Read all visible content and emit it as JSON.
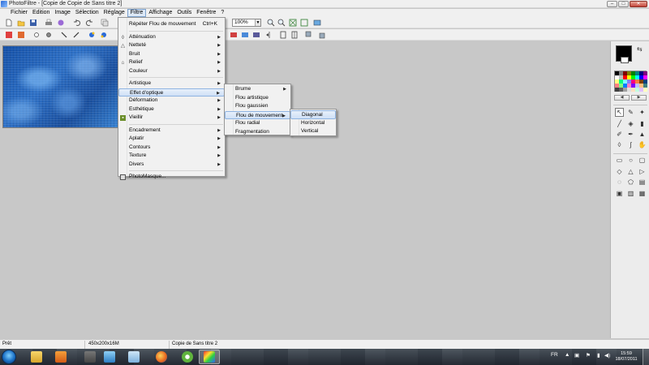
{
  "window": {
    "title": "PhotoFiltre - [Copie de Copie de Sans titre 2]",
    "buttons": {
      "minimize": "–",
      "maximize": "□",
      "close": "✕"
    }
  },
  "menubar": {
    "items": [
      "Fichier",
      "Edition",
      "Image",
      "Sélection",
      "Réglage",
      "Filtre",
      "Affichage",
      "Outils",
      "Fenêtre",
      "?"
    ],
    "active": "Filtre"
  },
  "toolbar": {
    "zoom_value": "100%"
  },
  "filtre_menu": {
    "repeat": {
      "label": "Répéter Flou de mouvement",
      "shortcut": "Ctrl+K"
    },
    "group1": [
      {
        "label": "Atténuation",
        "icon": "drop-icon"
      },
      {
        "label": "Netteté",
        "icon": "triangle-icon"
      },
      {
        "label": "Bruit"
      },
      {
        "label": "Relief",
        "icon": "relief-icon"
      },
      {
        "label": "Couleur"
      }
    ],
    "group2": [
      {
        "label": "Artistique"
      },
      {
        "label": "Effet d'optique"
      },
      {
        "label": "Déformation"
      },
      {
        "label": "Esthétique"
      },
      {
        "label": "Vieillir",
        "icon": "vieillir-icon"
      }
    ],
    "group3": [
      {
        "label": "Encadrement"
      },
      {
        "label": "Aplatir"
      },
      {
        "label": "Contours"
      },
      {
        "label": "Texture"
      },
      {
        "label": "Divers"
      }
    ],
    "photomasque": {
      "label": "PhotoMasque...",
      "icon": "photomasque-icon"
    },
    "highlighted": "Effet d'optique"
  },
  "optique_menu": {
    "items": [
      "Brume",
      "Flou artistique",
      "Flou gaussien",
      "Flou de mouvement",
      "Flou radial",
      "Fragmentation"
    ],
    "highlighted": "Flou de mouvement"
  },
  "flou_menu": {
    "items": [
      "Diagonal",
      "Horizontal",
      "Vertical"
    ],
    "highlighted": "Diagonal"
  },
  "statusbar": {
    "state": "Prêt",
    "image_info": "450x200x16M",
    "document": "Copie de Sans titre 2"
  },
  "palette_colors": [
    "#000000",
    "#808080",
    "#800000",
    "#808000",
    "#008000",
    "#008080",
    "#000080",
    "#800080",
    "#ffffff",
    "#c0c0c0",
    "#ff0000",
    "#ffff00",
    "#00ff00",
    "#00ffff",
    "#0000ff",
    "#ff00ff",
    "#ffff80",
    "#00ff80",
    "#80ffff",
    "#8080ff",
    "#ff0080",
    "#ff8040",
    "#804000",
    "#004080",
    "#ff8080",
    "#80ff80",
    "#0080ff",
    "#ff80c0",
    "#8000ff",
    "#c0c0ff",
    "#ffc080",
    "#408080",
    "#404040",
    "#606060",
    "#a0a0a0",
    "#e0e0e0",
    "#ffe0c0",
    "#c0ffe0",
    "#e0c0ff",
    "#ffffc0"
  ],
  "taskbar": {
    "language": "FR",
    "time": "15:59",
    "date": "18/07/2011"
  },
  "colors": {
    "canvas_background": "#c8c8c8",
    "menu_highlight": "#cfe0f6",
    "foreground_color": "#000000",
    "background_color": "#ffffff"
  }
}
